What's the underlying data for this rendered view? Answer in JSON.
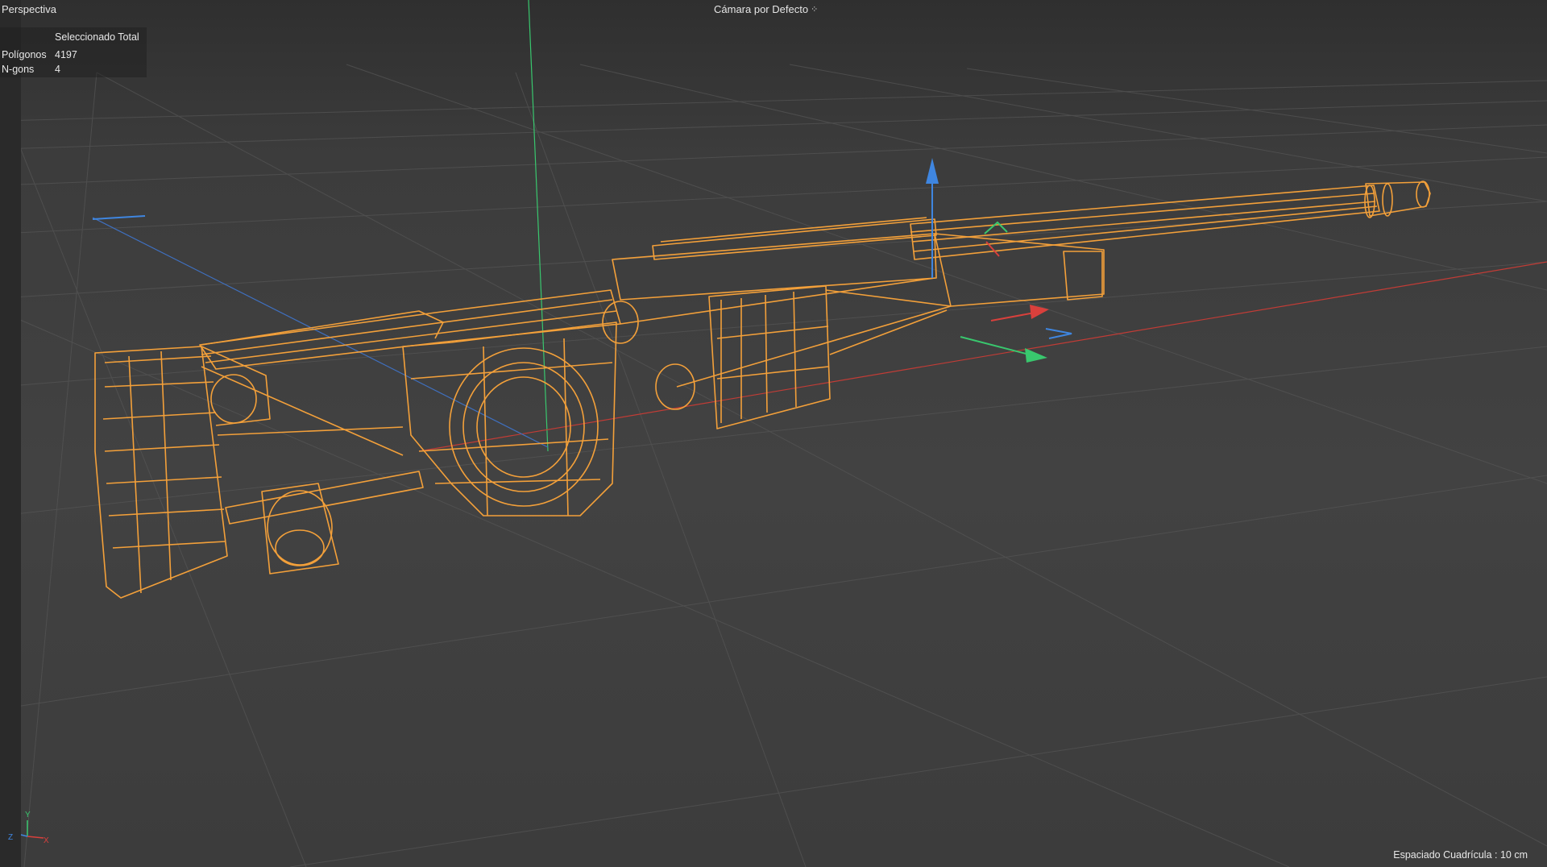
{
  "viewport": {
    "view_name": "Perspectiva",
    "camera_name": "Cámara por Defecto",
    "camera_icon": "camera-dots-icon",
    "background": "#3f3f3f"
  },
  "stats_hud": {
    "header": "Seleccionado Total",
    "rows": [
      {
        "label": "Polígonos",
        "value": "4197"
      },
      {
        "label": "N-gons",
        "value": "4"
      }
    ]
  },
  "grid_spacing": "Espaciado Cuadrícula : 10 cm",
  "axis_gizmo": {
    "y": "Y",
    "z": "Z",
    "x": "X"
  },
  "colors": {
    "wireframe": "#f3a03a",
    "axis_x": "#d9403c",
    "axis_y": "#39c76e",
    "axis_z": "#3f86e0",
    "grid": "#5a5a5a"
  }
}
